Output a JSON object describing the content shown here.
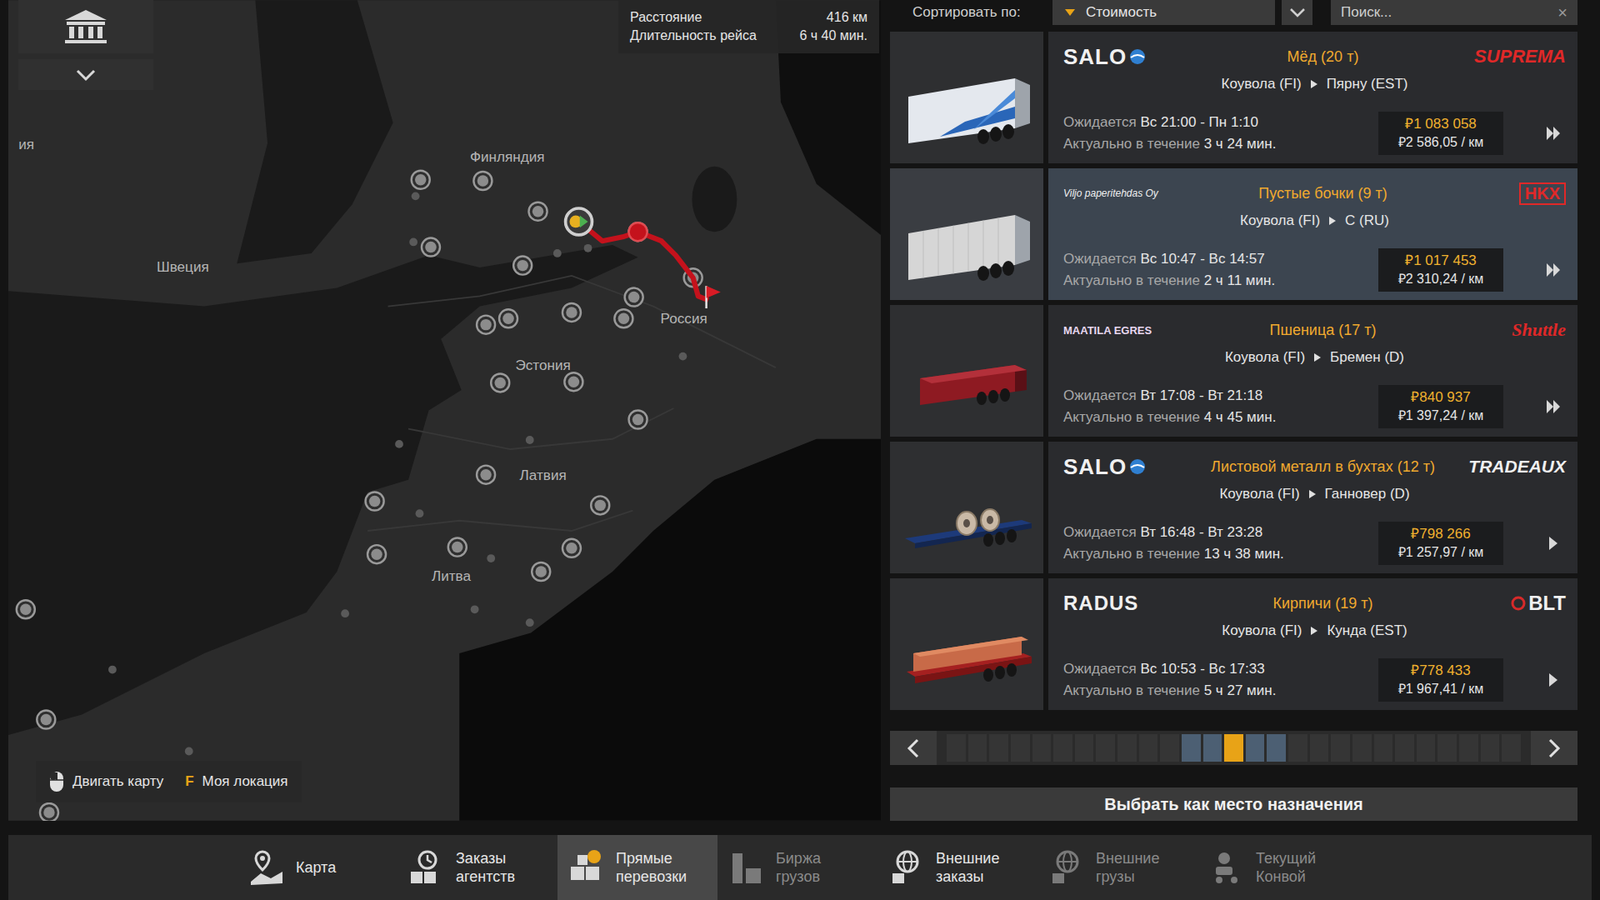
{
  "map": {
    "labels": [
      {
        "text": "ия"
      },
      {
        "text": "Финляндия"
      },
      {
        "text": "Швеция"
      },
      {
        "text": "Эстония"
      },
      {
        "text": "Латвия"
      },
      {
        "text": "Литва"
      },
      {
        "text": "Россия"
      }
    ],
    "info": [
      {
        "label": "Расстояние",
        "value": "416 км"
      },
      {
        "label": "Длительность рейса",
        "value": "6 ч 40 мин."
      }
    ],
    "hints": [
      {
        "kind": "mouse",
        "key": "",
        "label": "Двигать карту"
      },
      {
        "kind": "key",
        "key": "F",
        "label": "Моя локация"
      }
    ]
  },
  "sort": {
    "label": "Сортировать по:",
    "value": "Стоимость"
  },
  "search": {
    "placeholder": "Поиск...",
    "clear_icon": "×"
  },
  "jobs": [
    {
      "selected": false,
      "trailer": "reefer",
      "arrow": "double",
      "logo": {
        "text": "SALO",
        "kind": "salo"
      },
      "partner": {
        "text": "SUPREMA",
        "kind": "suprema"
      },
      "cargo": "Мёд (20 т)",
      "origin": "Коувола (FI)",
      "destination": "Пярну (EST)",
      "expected_label": "Ожидается",
      "expected": "Вс 21:00 - Пн 1:10",
      "valid_label": "Актуально в течение",
      "valid": "3 ч 24 мин.",
      "price": "₽1 083 058",
      "per_km": "₽2 586,05 / км"
    },
    {
      "selected": true,
      "trailer": "curtain",
      "arrow": "double",
      "logo": {
        "text": "Viljo paperitehdas Oy",
        "kind": "viljo"
      },
      "partner": {
        "text": "HKX",
        "kind": "hkx"
      },
      "cargo": "Пустые бочки (9 т)",
      "origin": "Коувола (FI)",
      "destination": "С (RU)",
      "expected_label": "Ожидается",
      "expected": "Вс 10:47 - Вс 14:57",
      "valid_label": "Актуально в течение",
      "valid": "2 ч 11 мин.",
      "price": "₽1 017 453",
      "per_km": "₽2 310,24 / км"
    },
    {
      "selected": false,
      "trailer": "tipper",
      "arrow": "double",
      "logo": {
        "text": "MAATILA EGRES",
        "kind": "maatila"
      },
      "partner": {
        "text": "Shuttle",
        "kind": "shuttle"
      },
      "cargo": "Пшеница (17 т)",
      "origin": "Коувола (FI)",
      "destination": "Бремен (D)",
      "expected_label": "Ожидается",
      "expected": "Вт 17:08 - Вт 21:18",
      "valid_label": "Актуально в течение",
      "valid": "4 ч 45 мин.",
      "price": "₽840 937",
      "per_km": "₽1 397,24 / км"
    },
    {
      "selected": false,
      "trailer": "coil",
      "arrow": "single",
      "logo": {
        "text": "SALO",
        "kind": "salo"
      },
      "partner": {
        "text": "TRADEAUX",
        "kind": "tradeaux"
      },
      "cargo": "Листовой металл в бухтах (12 т)",
      "origin": "Коувола (FI)",
      "destination": "Ганновер (D)",
      "expected_label": "Ожидается",
      "expected": "Вт 16:48 - Вт 23:28",
      "valid_label": "Актуально в течение",
      "valid": "13 ч 38 мин.",
      "price": "₽798 266",
      "per_km": "₽1 257,97 / км"
    },
    {
      "selected": false,
      "trailer": "bricks",
      "arrow": "single",
      "logo": {
        "text": "RADUS",
        "kind": "radus"
      },
      "partner": {
        "text": "BLT",
        "kind": "blt"
      },
      "cargo": "Кирпичи (19 т)",
      "origin": "Коувола (FI)",
      "destination": "Кунда (EST)",
      "expected_label": "Ожидается",
      "expected": "Вс 10:53 - Вс 17:33",
      "valid_label": "Актуально в течение",
      "valid": "5 ч 27 мин.",
      "price": "₽778 433",
      "per_km": "₽1 967,41 / км"
    }
  ],
  "pagination": {
    "pages": [
      {
        "selected": false,
        "nearby": false
      },
      {
        "selected": false,
        "nearby": false
      },
      {
        "selected": false,
        "nearby": false
      },
      {
        "selected": false,
        "nearby": false
      },
      {
        "selected": false,
        "nearby": false
      },
      {
        "selected": false,
        "nearby": false
      },
      {
        "selected": false,
        "nearby": false
      },
      {
        "selected": false,
        "nearby": false
      },
      {
        "selected": false,
        "nearby": false
      },
      {
        "selected": false,
        "nearby": false
      },
      {
        "selected": false,
        "nearby": false
      },
      {
        "selected": false,
        "nearby": true
      },
      {
        "selected": false,
        "nearby": true
      },
      {
        "selected": true,
        "nearby": false
      },
      {
        "selected": false,
        "nearby": true
      },
      {
        "selected": false,
        "nearby": true
      },
      {
        "selected": false,
        "nearby": false
      },
      {
        "selected": false,
        "nearby": false
      },
      {
        "selected": false,
        "nearby": false
      },
      {
        "selected": false,
        "nearby": false
      },
      {
        "selected": false,
        "nearby": false
      },
      {
        "selected": false,
        "nearby": false
      },
      {
        "selected": false,
        "nearby": false
      },
      {
        "selected": false,
        "nearby": false
      },
      {
        "selected": false,
        "nearby": false
      },
      {
        "selected": false,
        "nearby": false
      },
      {
        "selected": false,
        "nearby": false
      }
    ]
  },
  "select_button": "Выбрать как место назначения",
  "tabs": [
    {
      "label": "Карта",
      "selected": false,
      "disabled": false
    },
    {
      "label": "Заказы агентств",
      "selected": false,
      "disabled": false
    },
    {
      "label": "Прямые перевозки",
      "selected": true,
      "disabled": false
    },
    {
      "label": "Биржа грузов",
      "selected": false,
      "disabled": true
    },
    {
      "label": "Внешние заказы",
      "selected": false,
      "disabled": false
    },
    {
      "label": "Внешние грузы",
      "selected": false,
      "disabled": true
    },
    {
      "label": "Текущий Конвой",
      "selected": false,
      "disabled": true
    }
  ]
}
